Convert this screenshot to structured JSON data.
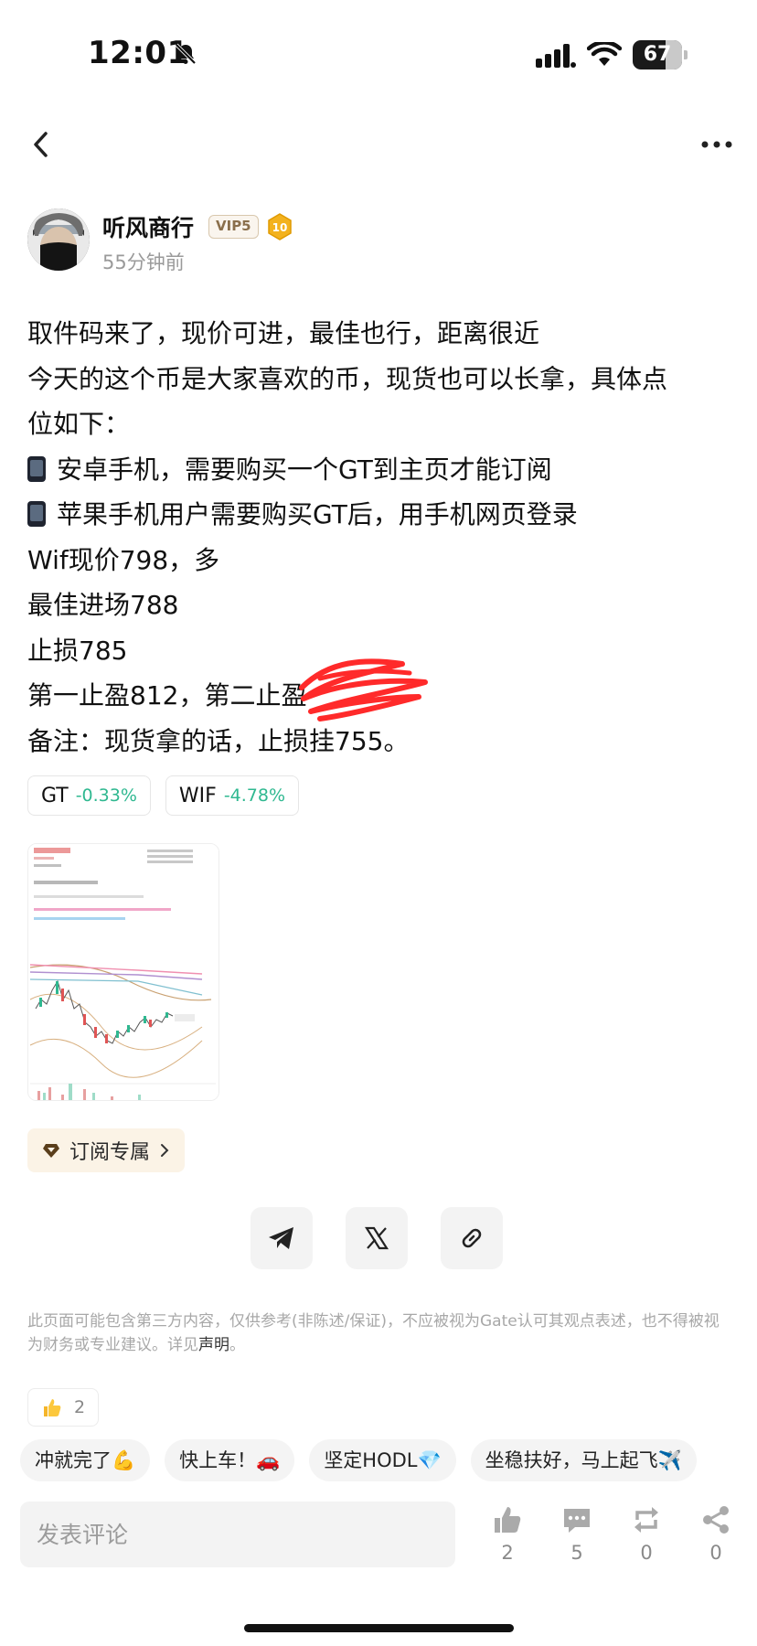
{
  "status_bar": {
    "time": "12:01",
    "battery": "67",
    "battery_level": 0.67
  },
  "author": {
    "name": "听风商行",
    "vip": "VIP5",
    "level": "10",
    "posted": "55分钟前"
  },
  "post": {
    "lines": [
      "取件码来了，现价可进，最佳也行，距离很近",
      "今天的这个币是大家喜欢的币，现货也可以长拿，具体点",
      "位如下：",
      "安卓手机，需要购买一个GT到主页才能订阅",
      "苹果手机用户需要购买GT后，用手机网页登录",
      "Wif现价798，多",
      "最佳进场788",
      "止损785",
      "第一止盈812，第二止盈",
      "备注：现货拿的话，止损挂755。"
    ],
    "icons": {
      "line_3": "mobile-phone-emoji",
      "line_4": "mobile-phone-emoji"
    }
  },
  "tickers": [
    {
      "symbol": "GT",
      "change": "-0.33%"
    },
    {
      "symbol": "WIF",
      "change": "-4.78%"
    }
  ],
  "subscribe": {
    "label": "订阅专属"
  },
  "share": {
    "icons": [
      "telegram-icon",
      "x-icon",
      "link-icon"
    ]
  },
  "disclaimer": {
    "text": "此页面可能包含第三方内容，仅供参考(非陈述/保证)，不应被视为Gate认可其观点表述，也不得被视为财务或专业建议。详见",
    "link": "声明",
    "end": "。"
  },
  "like_chip": {
    "count": "2"
  },
  "quick_replies": [
    "冲就完了💪",
    "快上车！🚗",
    "坚定HODL💎",
    "坐稳扶好，马上起飞✈️"
  ],
  "comment": {
    "placeholder": "发表评论"
  },
  "actions": [
    {
      "name": "like",
      "count": "2"
    },
    {
      "name": "comment",
      "count": "5"
    },
    {
      "name": "repost",
      "count": "0"
    },
    {
      "name": "share",
      "count": "0"
    }
  ],
  "colors": {
    "positive_green": "#2fb890",
    "vip_gold": "#8a6f4c",
    "subscribe_bg": "#fbf3e6"
  }
}
